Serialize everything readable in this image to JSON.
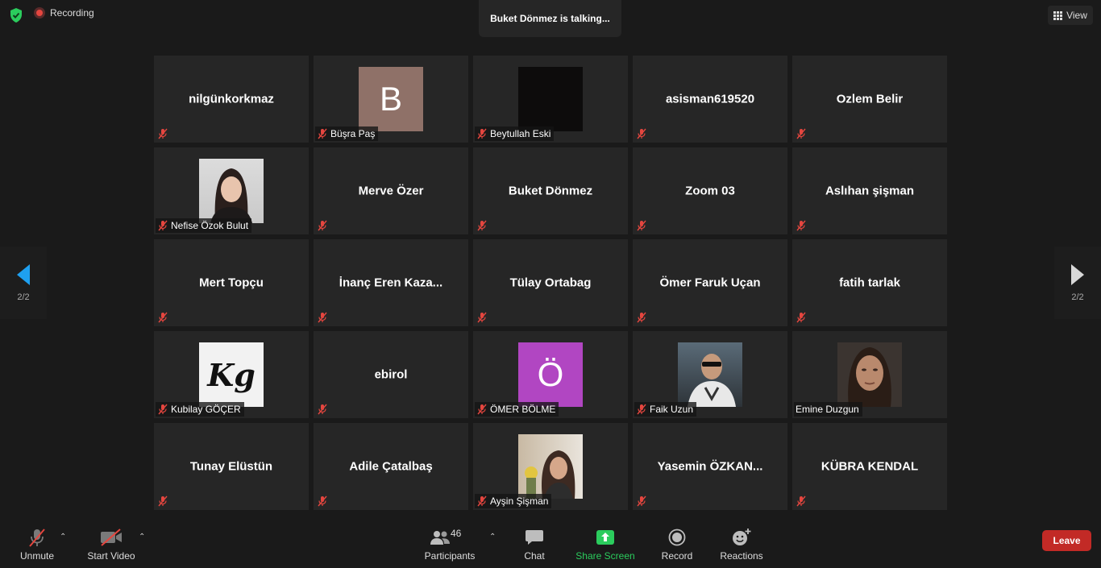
{
  "top": {
    "recording_label": "Recording",
    "talking_banner": "Buket Dönmez is talking...",
    "view_label": "View"
  },
  "paging": {
    "left_page": "2/2",
    "right_page": "2/2"
  },
  "tiles": [
    {
      "name": "nilgünkorkmaz",
      "label": "",
      "avatar": "none"
    },
    {
      "name": "Büşra Paş",
      "label": "Büşra Paş",
      "avatar": "letter",
      "letter": "B",
      "color": "#8f7168"
    },
    {
      "name": "Beytullah Eski",
      "label": "Beytullah Eski",
      "avatar": "dark-photo",
      "color": "#0d0c0c"
    },
    {
      "name": "asisman619520",
      "label": "",
      "avatar": "none"
    },
    {
      "name": "Ozlem Belir",
      "label": "",
      "avatar": "none"
    },
    {
      "name": "Nefise Özok Bulut",
      "label": "Nefise Özok Bulut",
      "avatar": "portrait-photo"
    },
    {
      "name": "Merve Özer",
      "label": "",
      "avatar": "none"
    },
    {
      "name": "Buket Dönmez",
      "label": "",
      "avatar": "none"
    },
    {
      "name": "Zoom 03",
      "label": "",
      "avatar": "none"
    },
    {
      "name": "Aslıhan şişman",
      "label": "",
      "avatar": "none"
    },
    {
      "name": "Mert Topçu",
      "label": "",
      "avatar": "none"
    },
    {
      "name": "İnanç Eren Kaza...",
      "label": "",
      "avatar": "none"
    },
    {
      "name": "Tülay Ortabag",
      "label": "",
      "avatar": "none"
    },
    {
      "name": "Ömer Faruk Uçan",
      "label": "",
      "avatar": "none"
    },
    {
      "name": "fatih tarlak",
      "label": "",
      "avatar": "none"
    },
    {
      "name": "Kubilay GÖÇER",
      "label": "Kubilay GÖÇER",
      "avatar": "logo-kg"
    },
    {
      "name": "ebirol",
      "label": "",
      "avatar": "none"
    },
    {
      "name": "ÖMER BÖLME",
      "label": "ÖMER BÖLME",
      "avatar": "letter",
      "letter": "Ö",
      "color": "#b146c2"
    },
    {
      "name": "Faik Uzun",
      "label": "Faik Uzun",
      "avatar": "man-photo"
    },
    {
      "name": "Emine Duzgun",
      "label": "Emine Duzgun",
      "avatar": "woman-photo",
      "muted": false
    },
    {
      "name": "Tunay Elüstün",
      "label": "",
      "avatar": "none"
    },
    {
      "name": "Adile Çatalbaş",
      "label": "",
      "avatar": "none"
    },
    {
      "name": "Ayşin Şişman",
      "label": "Ayşin Şişman",
      "avatar": "woman2-photo"
    },
    {
      "name": "Yasemin ÖZKAN...",
      "label": "",
      "avatar": "none"
    },
    {
      "name": "KÜBRA KENDAL",
      "label": "",
      "avatar": "none"
    }
  ],
  "toolbar": {
    "unmute": "Unmute",
    "start_video": "Start Video",
    "participants": "Participants",
    "participants_count": "46",
    "chat": "Chat",
    "share_screen": "Share Screen",
    "record": "Record",
    "reactions": "Reactions",
    "leave": "Leave"
  },
  "colors": {
    "accent_share": "#2bcc5d",
    "leave": "#c22a26",
    "nav_arrow_active": "#1ea0f0",
    "mute_red": "#e5463f"
  }
}
